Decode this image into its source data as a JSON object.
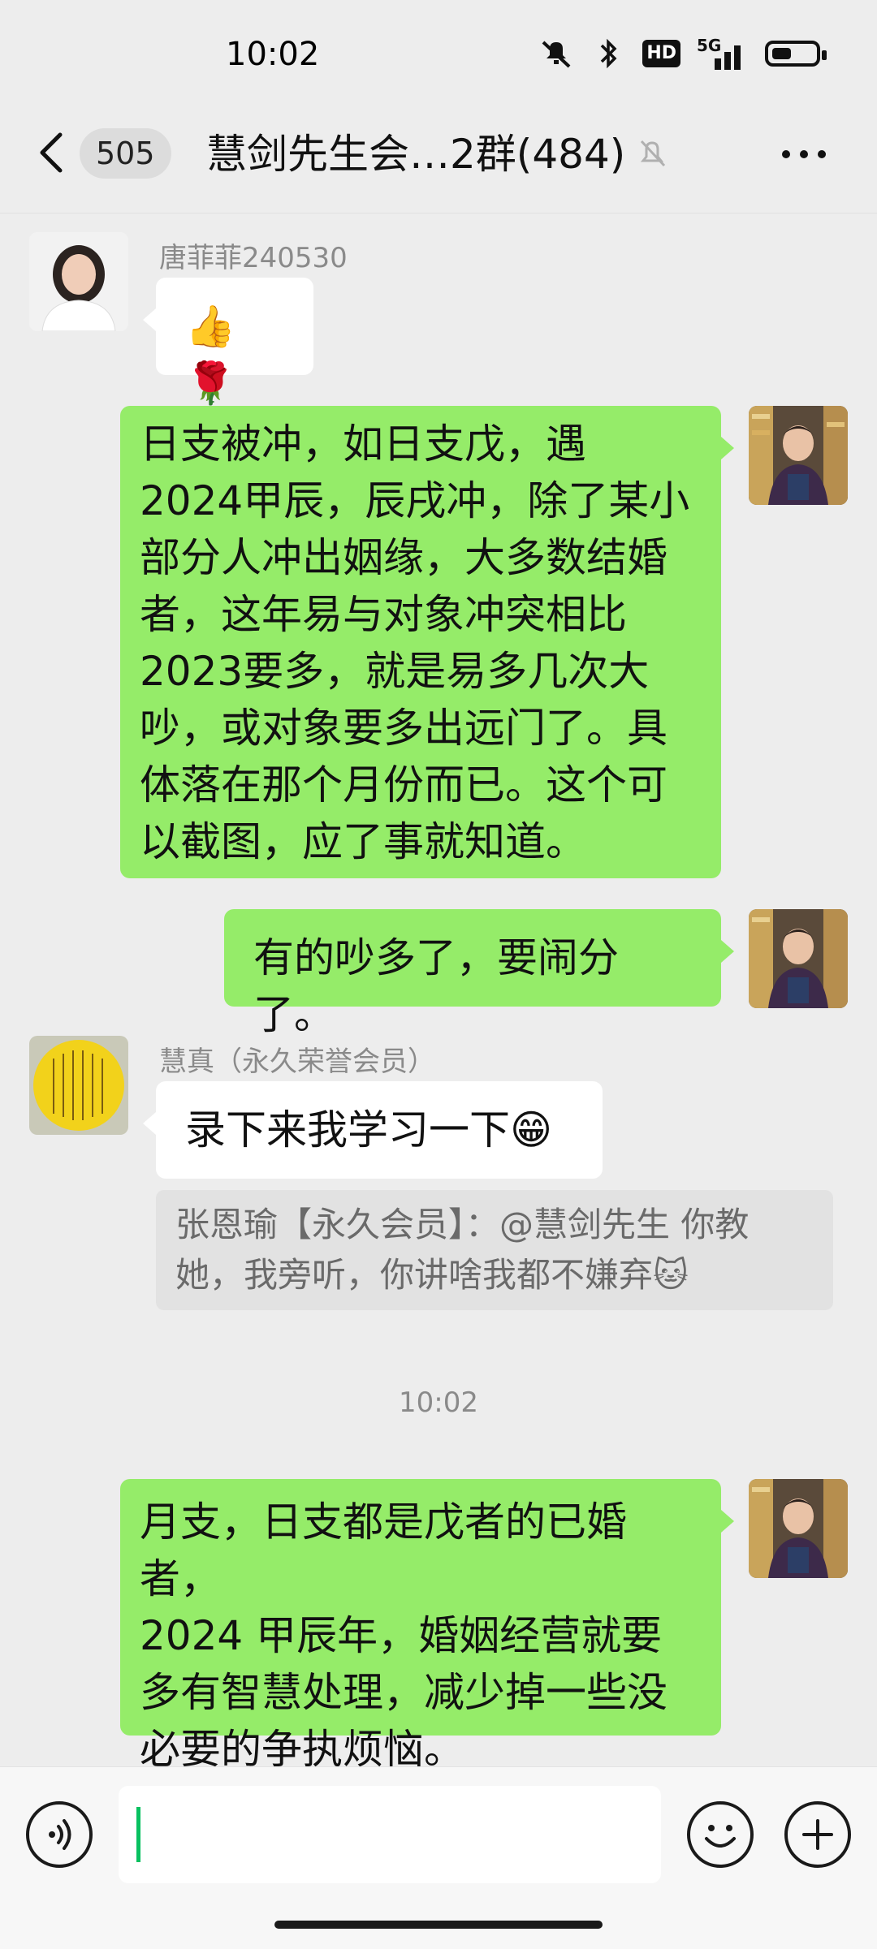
{
  "status_bar": {
    "time": "10:02",
    "icons": [
      "mute-icon",
      "bluetooth-icon",
      "hd-icon",
      "5g-signal-icon",
      "battery-icon"
    ],
    "hd_label": "HD",
    "network_label": "5G",
    "battery_level": 0.45
  },
  "header": {
    "back_icon": "chevron-left-icon",
    "unread_count": "505",
    "title": "慧剑先生会…2群(484)",
    "mute_icon": "bell-off-icon",
    "more_icon": "more-dots-icon"
  },
  "messages": [
    {
      "sender": "唐菲菲240530",
      "text": "👍🌹",
      "side": "left"
    },
    {
      "side": "right",
      "lines": [
        "日支被冲，如日支戊，遇",
        "2024甲辰，辰戌冲，除了某小",
        "部分人冲出姻缘，大多数结婚",
        "者，这年易与对象冲突相比",
        "2023要多，就是易多几次大",
        "吵，或对象要多出远门了。具",
        "体落在那个月份而已。这个可",
        "以截图，应了事就知道。"
      ]
    },
    {
      "side": "right",
      "text": "有的吵多了，要闹分了。"
    },
    {
      "side": "left",
      "sender": "慧真（永久荣誉会员）",
      "text": "录下来我学习一下😁",
      "quote_lines": [
        "张恩瑜【永久会员】：@慧剑先生 你教",
        "她，我旁听，你讲啥我都不嫌弃🐱"
      ]
    },
    {
      "type": "timestamp",
      "text": "10:02"
    },
    {
      "side": "right",
      "lines": [
        "月支，日支都是戊者的已婚者，",
        "2024 甲辰年，婚姻经营就要",
        "多有智慧处理，减少掉一些没",
        "必要的争执烦恼。"
      ]
    }
  ],
  "input_bar": {
    "voice_icon": "voice-icon",
    "emoji_icon": "emoji-icon",
    "plus_icon": "plus-icon",
    "input_value": ""
  },
  "colors": {
    "bubble_green": "#95ec69",
    "background": "#ededed",
    "cursor": "#07c160"
  }
}
